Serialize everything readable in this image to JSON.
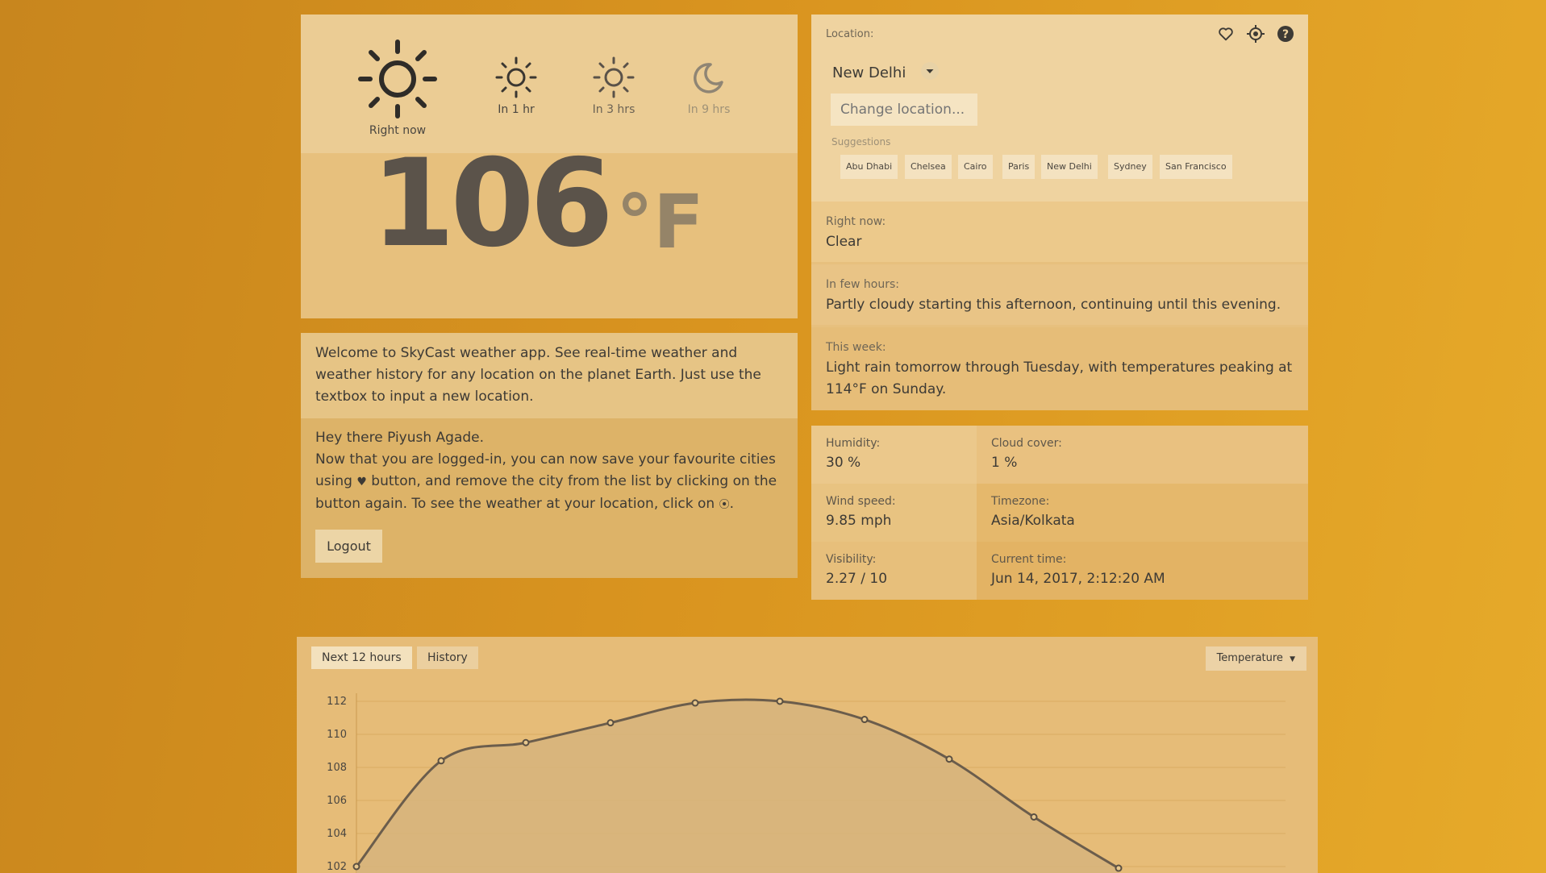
{
  "forecast": {
    "now": {
      "label": "Right now",
      "icon": "sun-icon"
    },
    "slots": [
      {
        "label": "In 1 hr",
        "icon": "sun-icon"
      },
      {
        "label": "In 3 hrs",
        "icon": "sun-icon"
      },
      {
        "label": "In 9 hrs",
        "icon": "moon-icon"
      }
    ],
    "temperature": "106",
    "unit": "°F"
  },
  "welcome": {
    "intro": "Welcome to SkyCast weather app. See real-time weather and weather history for any location on the planet Earth. Just use the textbox to input a new location.",
    "greeting": "Hey there Piyush Agade.",
    "msg1": "Now that you are logged-in, you can now save your favourite cities using ",
    "msg2": " button, and remove the city from the list by clicking on the button again. To see the weather at your location, click on ",
    "msg3": ".",
    "logout_label": "Logout"
  },
  "location": {
    "label": "Location:",
    "city": "New Delhi",
    "change_placeholder": "Change location...",
    "suggestions_label": "Suggestions",
    "suggestions": [
      "Abu Dhabi",
      "Chelsea",
      "Cairo",
      "Paris",
      "New Delhi",
      "Sydney",
      "San Francisco"
    ]
  },
  "summary": {
    "now_label": "Right now:",
    "now": "Clear",
    "hours_label": "In few hours:",
    "hours": "Partly cloudy starting this afternoon, continuing until this evening.",
    "week_label": "This week:",
    "week": "Light rain tomorrow through Tuesday, with temperatures peaking at 114°F on Sunday."
  },
  "details": {
    "humidity_label": "Humidity:",
    "humidity": "30 %",
    "cloud_label": "Cloud cover:",
    "cloud": "1 %",
    "wind_label": "Wind speed:",
    "wind": "9.85 mph",
    "timezone_label": "Timezone:",
    "timezone": "Asia/Kolkata",
    "visibility_label": "Visibility:",
    "visibility": "2.27 / 10",
    "time_label": "Current time:",
    "time": "Jun 14, 2017, 2:12:20 AM"
  },
  "chart_tabs": {
    "next": "Next 12 hours",
    "history": "History",
    "metric": "Temperature"
  },
  "chart_data": {
    "type": "area",
    "y_ticks": [
      "112",
      "110",
      "108",
      "106",
      "104",
      "102"
    ],
    "ylim": [
      101,
      112
    ],
    "x": [
      0,
      1,
      2,
      3,
      4,
      5,
      6,
      7,
      8,
      9
    ],
    "values": [
      102,
      108.4,
      109.5,
      110.7,
      111.9,
      112,
      110.9,
      108.5,
      105,
      101.9
    ]
  }
}
